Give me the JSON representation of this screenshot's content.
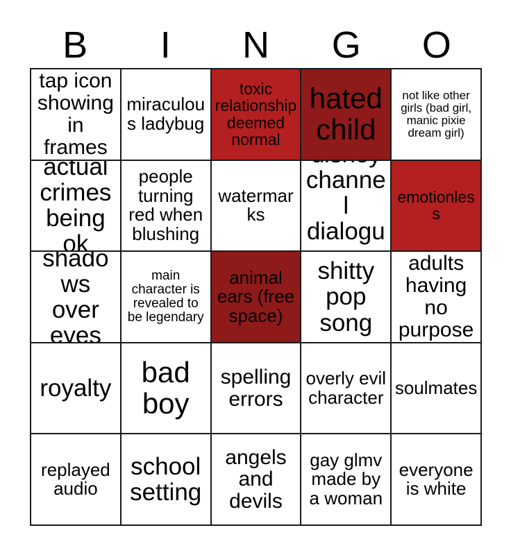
{
  "card": {
    "type": "bingo-card",
    "columns": 5,
    "rows": 5,
    "headers": [
      "B",
      "I",
      "N",
      "G",
      "O"
    ],
    "colors": {
      "marked_bright": "#b4201f",
      "marked_dark": "#8e1a1a",
      "unmarked": "#ffffff",
      "text": "#000000",
      "border": "#1a1a1a"
    },
    "cells": [
      {
        "text": "tap icon showing in frames",
        "marked": false,
        "size": "lg"
      },
      {
        "text": "miraculous ladybug",
        "marked": false,
        "size": "md"
      },
      {
        "text": "toxic relationship deemed normal",
        "marked": true,
        "mark": "bright",
        "size": "sm"
      },
      {
        "text": "hated child",
        "marked": true,
        "mark": "dark",
        "size": "xxl"
      },
      {
        "text": "not like other girls (bad girl, manic pixie dream girl)",
        "marked": false,
        "size": "xxs"
      },
      {
        "text": "actual crimes being ok",
        "marked": false,
        "size": "xl"
      },
      {
        "text": "people turning red when blushing",
        "marked": false,
        "size": "md"
      },
      {
        "text": "watermarks",
        "marked": false,
        "size": "md"
      },
      {
        "text": "disney channel dialogue",
        "marked": false,
        "size": "xl"
      },
      {
        "text": "emotionless",
        "marked": true,
        "mark": "bright",
        "size": "sm"
      },
      {
        "text": "shadows over eyes",
        "marked": false,
        "size": "xl"
      },
      {
        "text": "main character is revealed to be legendary",
        "marked": false,
        "size": "xs"
      },
      {
        "text": "animal ears (free space)",
        "marked": true,
        "mark": "dark",
        "size": "md"
      },
      {
        "text": "shitty pop song",
        "marked": false,
        "size": "xl"
      },
      {
        "text": "adults having no purpose",
        "marked": false,
        "size": "lg"
      },
      {
        "text": "royalty",
        "marked": false,
        "size": "xl"
      },
      {
        "text": "bad boy",
        "marked": false,
        "size": "xxl"
      },
      {
        "text": "spelling errors",
        "marked": false,
        "size": "lg"
      },
      {
        "text": "overly evil character",
        "marked": false,
        "size": "md"
      },
      {
        "text": "soulmates",
        "marked": false,
        "size": "md"
      },
      {
        "text": "replayed audio",
        "marked": false,
        "size": "md"
      },
      {
        "text": "school setting",
        "marked": false,
        "size": "xl"
      },
      {
        "text": "angels and devils",
        "marked": false,
        "size": "lg"
      },
      {
        "text": "gay glmv made by a woman",
        "marked": false,
        "size": "md"
      },
      {
        "text": "everyone is white",
        "marked": false,
        "size": "md"
      }
    ]
  }
}
